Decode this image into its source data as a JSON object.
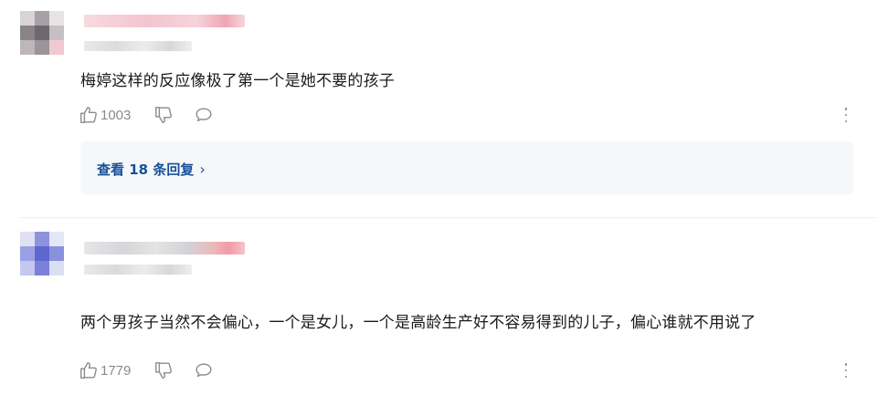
{
  "comments": [
    {
      "text": "梅婷这样的反应像极了第一个是她不要的孩子",
      "like_count": "1003",
      "replies_label": "查看 18 条回复",
      "replies_chevron": "›"
    },
    {
      "text": "两个男孩子当然不会偏心，一个是女儿，一个是高龄生产好不容易得到的儿子，偏心谁就不用说了",
      "like_count": "1779"
    }
  ],
  "colors": {
    "link": "#175199",
    "muted": "#8a8a8a",
    "reply_bg": "#f6f7f9"
  },
  "icons": [
    "thumbs-up-icon",
    "thumbs-down-icon",
    "comment-bubble-icon",
    "more-vertical-icon"
  ]
}
